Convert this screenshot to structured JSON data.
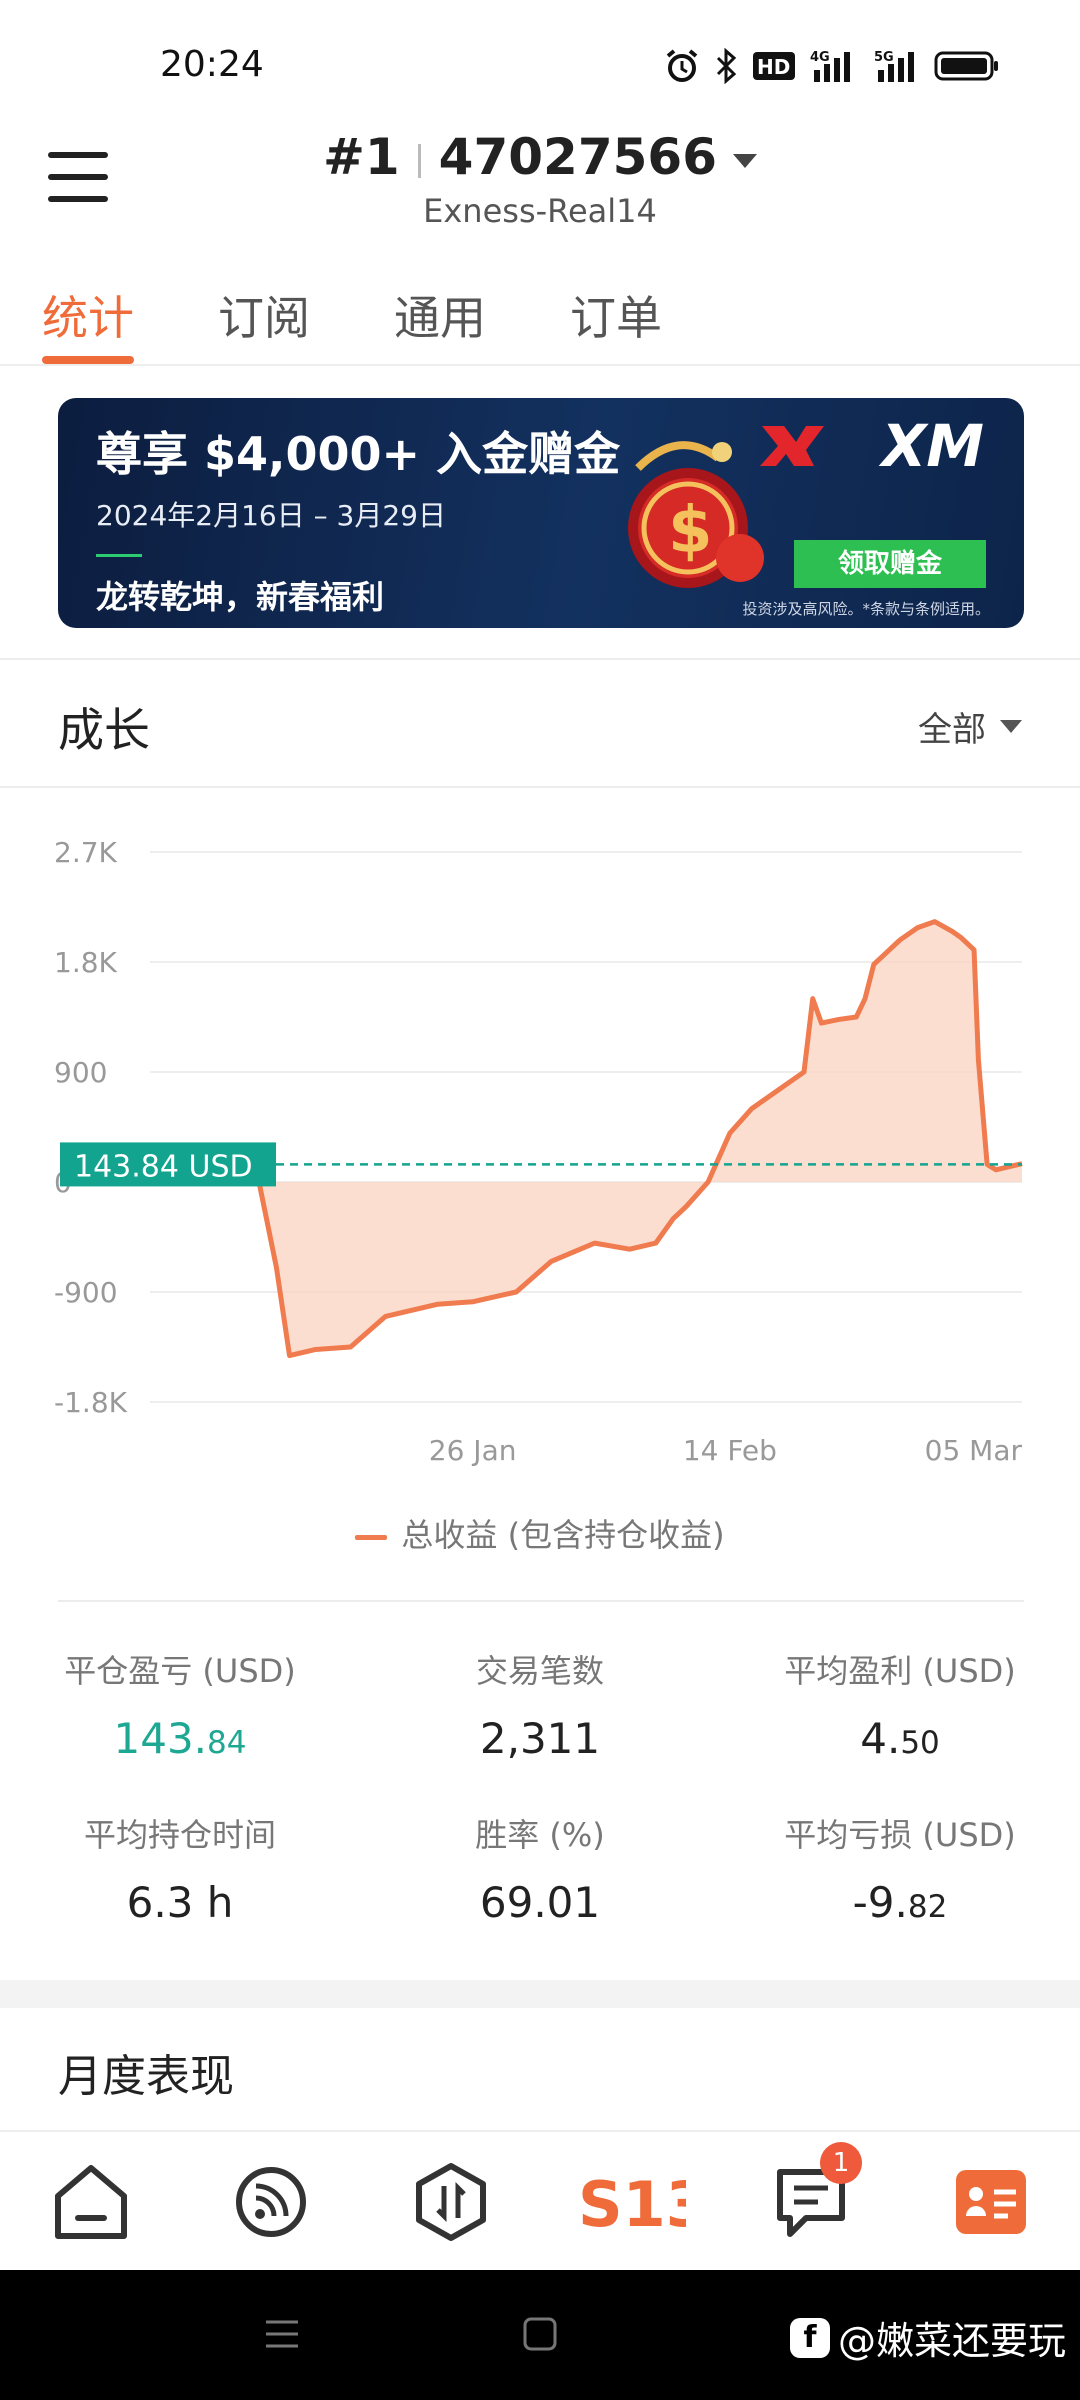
{
  "status_bar": {
    "time": "20:24",
    "icons": [
      "alarm-icon",
      "bluetooth-icon",
      "hd-icon",
      "4g-signal-icon",
      "5g-signal-icon",
      "battery-icon"
    ],
    "hd_label": "HD",
    "net1": "4G",
    "net2": "5G"
  },
  "header": {
    "rank": "#1",
    "account_number": "47027566",
    "server": "Exness-Real14"
  },
  "tabs": [
    {
      "label": "统计",
      "active": true
    },
    {
      "label": "订阅",
      "active": false
    },
    {
      "label": "通用",
      "active": false
    },
    {
      "label": "订单",
      "active": false
    }
  ],
  "banner": {
    "headline": "尊享 $4,000+ 入金赠金",
    "dates": "2024年2月16日 – 3月29日",
    "slogan": "龙转乾坤，新春福利",
    "brand": "XM",
    "cta": "领取赠金",
    "disclaimer": "投资涉及高风险。*条款与条例适用。",
    "colors": {
      "background": "#0f2750",
      "cta": "#2ebf53"
    }
  },
  "growth": {
    "title": "成长",
    "filter": "全部",
    "current_value_label": "143.84 USD",
    "legend": "总收益 (包含持仓收益)",
    "colors": {
      "line": "#ef7b4f",
      "fill": "#fbd3c0",
      "current_tag": "#12a48f"
    }
  },
  "chart_data": {
    "type": "area",
    "title": "",
    "xlabel": "",
    "ylabel": "",
    "ylim": [
      -1800,
      2700
    ],
    "y_ticks": [
      "2.7K",
      "1.8K",
      "900",
      "0",
      "-900",
      "-1.8K"
    ],
    "y_tick_values": [
      2700,
      1800,
      900,
      0,
      -900,
      -1800
    ],
    "x_ticks": [
      "26 Jan",
      "14 Feb",
      "05 Mar"
    ],
    "x_tick_positions": [
      0.37,
      0.665,
      0.97
    ],
    "grid": true,
    "current_value": 143.84,
    "series": [
      {
        "name": "总收益 (包含持仓收益)",
        "x": [
          0.0,
          0.09,
          0.115,
          0.125,
          0.145,
          0.16,
          0.19,
          0.23,
          0.27,
          0.33,
          0.37,
          0.42,
          0.46,
          0.51,
          0.55,
          0.58,
          0.6,
          0.615,
          0.64,
          0.665,
          0.69,
          0.72,
          0.75,
          0.76,
          0.77,
          0.79,
          0.81,
          0.82,
          0.83,
          0.86,
          0.88,
          0.9,
          0.92,
          0.93,
          0.945,
          0.95,
          0.96,
          0.97,
          1.0
        ],
        "values": [
          143.84,
          160,
          300,
          0,
          -700,
          -1420,
          -1370,
          -1350,
          -1100,
          -1000,
          -980,
          -900,
          -650,
          -500,
          -550,
          -500,
          -300,
          -200,
          0,
          400,
          600,
          750,
          900,
          1500,
          1300,
          1330,
          1350,
          1500,
          1780,
          1980,
          2080,
          2130,
          2050,
          2000,
          1900,
          1000,
          143.84,
          100,
          150
        ]
      }
    ]
  },
  "stats": [
    {
      "label": "平仓盈亏 (USD)",
      "value_main": "143.",
      "value_small": "84",
      "positive": true
    },
    {
      "label": "交易笔数",
      "value_main": "2,311",
      "value_small": "",
      "positive": false
    },
    {
      "label": "平均盈利 (USD)",
      "value_main": "4.",
      "value_small": "50",
      "positive": false
    },
    {
      "label": "平均持仓时间",
      "value_main": "6.3 h",
      "value_small": "",
      "positive": false
    },
    {
      "label": "胜率 (%)",
      "value_main": "69.01",
      "value_small": "",
      "positive": false
    },
    {
      "label": "平均亏损 (USD)",
      "value_main": "-9.",
      "value_small": "82",
      "positive": false
    }
  ],
  "monthly": {
    "title": "月度表现"
  },
  "bottom_nav": {
    "items": [
      "home-icon",
      "signals-icon",
      "trade-icon",
      "s13-logo",
      "messages-icon",
      "profile-card-icon"
    ],
    "s13_label": "S13",
    "messages_badge": "1",
    "accent": "#ef6c3a"
  },
  "watermark": {
    "text": "@嫩菜还要玩"
  }
}
